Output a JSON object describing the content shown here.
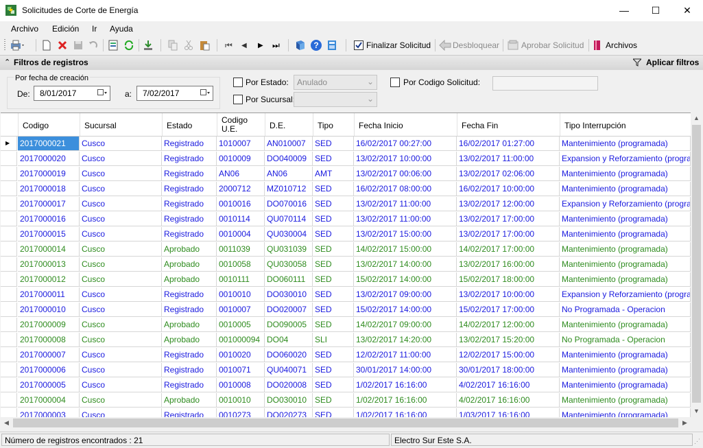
{
  "window": {
    "title": "Solicitudes de Corte de Energía",
    "minimize": "—",
    "maximize": "☐",
    "close": "✕"
  },
  "menu": [
    "Archivo",
    "Edición",
    "Ir",
    "Ayuda"
  ],
  "toolbar": {
    "finalizar_label": "Finalizar Solicitud",
    "desbloquear_label": "Desbloquear",
    "aprobar_label": "Aprobar Solicitud",
    "archivos_label": "Archivos"
  },
  "filters": {
    "bar_title": "Filtros de registros",
    "apply_label": "Aplicar filtros",
    "date_group_label": "Por fecha de creación",
    "from_label": "De:",
    "from_value": "8/01/2017",
    "to_label": "a:",
    "to_value": "7/02/2017",
    "estado_label": "Por Estado:",
    "estado_value": "Anulado",
    "sucursal_label": "Por Sucursal:",
    "sucursal_value": "",
    "codigo_label": "Por Codigo Solicitud:",
    "codigo_value": ""
  },
  "colors": {
    "registrado": "#1a1adf",
    "aprobado": "#2e8b1e",
    "selected_code_bg": "#3c8fdc"
  },
  "grid": {
    "columns": [
      "Codigo",
      "Sucursal",
      "Estado",
      "Codigo U.E.",
      "D.E.",
      "Tipo",
      "Fecha Inicio",
      "Fecha Fin",
      "Tipo Interrupción"
    ],
    "rows": [
      [
        "2017000021",
        "Cusco",
        "Registrado",
        "1010007",
        "AN010007",
        "SED",
        "16/02/2017 00:27:00",
        "16/02/2017 01:27:00",
        "Mantenimiento (programada)"
      ],
      [
        "2017000020",
        "Cusco",
        "Registrado",
        "0010009",
        "DO040009",
        "SED",
        "13/02/2017 10:00:00",
        "13/02/2017 11:00:00",
        "Expansion y Reforzamiento (programa..."
      ],
      [
        "2017000019",
        "Cusco",
        "Registrado",
        "AN06",
        "AN06",
        "AMT",
        "13/02/2017 00:06:00",
        "13/02/2017 02:06:00",
        "Mantenimiento (programada)"
      ],
      [
        "2017000018",
        "Cusco",
        "Registrado",
        "2000712",
        "MZ010712",
        "SED",
        "16/02/2017 08:00:00",
        "16/02/2017 10:00:00",
        "Mantenimiento (programada)"
      ],
      [
        "2017000017",
        "Cusco",
        "Registrado",
        "0010016",
        "DO070016",
        "SED",
        "13/02/2017 11:00:00",
        "13/02/2017 12:00:00",
        "Expansion y Reforzamiento (programa..."
      ],
      [
        "2017000016",
        "Cusco",
        "Registrado",
        "0010114",
        "QU070114",
        "SED",
        "13/02/2017 11:00:00",
        "13/02/2017 17:00:00",
        "Mantenimiento (programada)"
      ],
      [
        "2017000015",
        "Cusco",
        "Registrado",
        "0010004",
        "QU030004",
        "SED",
        "13/02/2017 15:00:00",
        "13/02/2017 17:00:00",
        "Mantenimiento (programada)"
      ],
      [
        "2017000014",
        "Cusco",
        "Aprobado",
        "0011039",
        "QU031039",
        "SED",
        "14/02/2017 15:00:00",
        "14/02/2017 17:00:00",
        "Mantenimiento (programada)"
      ],
      [
        "2017000013",
        "Cusco",
        "Aprobado",
        "0010058",
        "QU030058",
        "SED",
        "13/02/2017 14:00:00",
        "13/02/2017 16:00:00",
        "Mantenimiento (programada)"
      ],
      [
        "2017000012",
        "Cusco",
        "Aprobado",
        "0010111",
        "DO060111",
        "SED",
        "15/02/2017 14:00:00",
        "15/02/2017 18:00:00",
        "Mantenimiento (programada)"
      ],
      [
        "2017000011",
        "Cusco",
        "Registrado",
        "0010010",
        "DO030010",
        "SED",
        "13/02/2017 09:00:00",
        "13/02/2017 10:00:00",
        "Expansion y Reforzamiento (programa..."
      ],
      [
        "2017000010",
        "Cusco",
        "Registrado",
        "0010007",
        "DO020007",
        "SED",
        "15/02/2017 14:00:00",
        "15/02/2017 17:00:00",
        "No Programada - Operacion"
      ],
      [
        "2017000009",
        "Cusco",
        "Aprobado",
        "0010005",
        "DO090005",
        "SED",
        "14/02/2017 09:00:00",
        "14/02/2017 12:00:00",
        "Mantenimiento (programada)"
      ],
      [
        "2017000008",
        "Cusco",
        "Aprobado",
        "001000094",
        "DO04",
        "SLI",
        "13/02/2017 14:20:00",
        "13/02/2017 15:20:00",
        "No Programada - Operacion"
      ],
      [
        "2017000007",
        "Cusco",
        "Registrado",
        "0010020",
        "DO060020",
        "SED",
        "12/02/2017 11:00:00",
        "12/02/2017 15:00:00",
        "Mantenimiento (programada)"
      ],
      [
        "2017000006",
        "Cusco",
        "Registrado",
        "0010071",
        "QU040071",
        "SED",
        "30/01/2017 14:00:00",
        "30/01/2017 18:00:00",
        "Mantenimiento (programada)"
      ],
      [
        "2017000005",
        "Cusco",
        "Registrado",
        "0010008",
        "DO020008",
        "SED",
        "1/02/2017 16:16:00",
        "4/02/2017 16:16:00",
        "Mantenimiento (programada)"
      ],
      [
        "2017000004",
        "Cusco",
        "Aprobado",
        "0010010",
        "DO030010",
        "SED",
        "1/02/2017 16:16:00",
        "4/02/2017 16:16:00",
        "Mantenimiento (programada)"
      ],
      [
        "2017000003",
        "Cusco",
        "Registrado",
        "0010273",
        "DO020273",
        "SED",
        "1/02/2017 16:16:00",
        "1/03/2017 16:16:00",
        "Mantenimiento (programada)"
      ]
    ]
  },
  "status": {
    "count_label": "Número de registros encontrados : 21",
    "company": "Electro Sur Este S.A."
  }
}
